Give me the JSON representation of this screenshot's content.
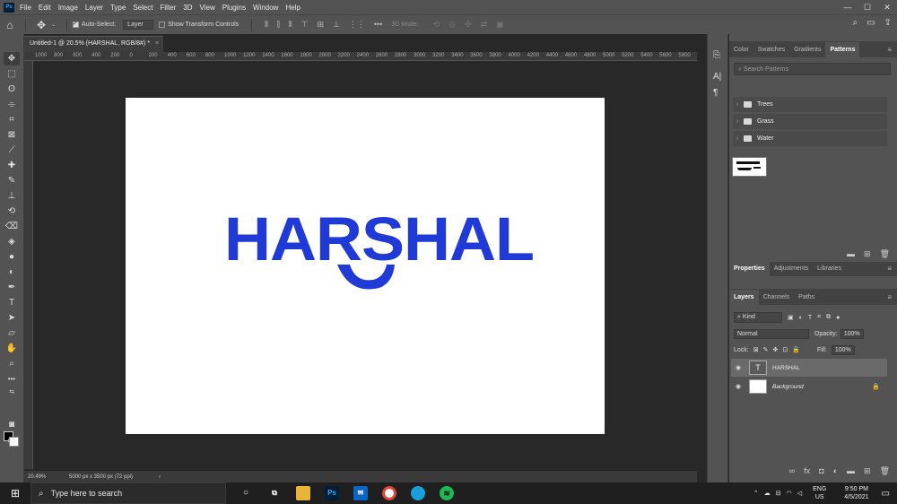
{
  "menu": {
    "items": [
      "File",
      "Edit",
      "Image",
      "Layer",
      "Type",
      "Select",
      "Filter",
      "3D",
      "View",
      "Plugins",
      "Window",
      "Help"
    ],
    "window_controls": [
      "—",
      "☐",
      "✕"
    ]
  },
  "options": {
    "auto_select_label": "Auto-Select:",
    "auto_select_value": "Layer",
    "transform_controls_label": "Show Transform Controls",
    "mode_3d_label": "3D Mode:"
  },
  "document": {
    "tab_title": "Untitled-1 @ 20.5% (HARSHAL, RGB/8#) *",
    "tab_close": "×",
    "canvas_text": "HARSHAL",
    "canvas_text_color": "#1f3ad6",
    "canvas_bg": "#ffffff",
    "ruler_labels": [
      "1000",
      "800",
      "600",
      "400",
      "200",
      "0",
      "200",
      "400",
      "600",
      "800",
      "1000",
      "1200",
      "1400",
      "1600",
      "1800",
      "2000",
      "2200",
      "2400",
      "2600",
      "2800",
      "3000",
      "3200",
      "3400",
      "3600",
      "3800",
      "4000",
      "4200",
      "4400",
      "4600",
      "4800",
      "5000",
      "5200",
      "5400",
      "5600",
      "5800"
    ]
  },
  "status": {
    "zoom": "20.49%",
    "doc_size": "5000 px x 3500 px (72 ppi)",
    "arrow": "›"
  },
  "toolbar": {
    "tools": [
      "move-tool-icon",
      "marquee-tool-icon",
      "lasso-tool-icon",
      "quick-select-tool-icon",
      "crop-tool-icon",
      "frame-tool-icon",
      "eyedropper-tool-icon",
      "healing-brush-tool-icon",
      "brush-tool-icon",
      "clone-stamp-tool-icon",
      "history-brush-tool-icon",
      "eraser-tool-icon",
      "paint-bucket-tool-icon",
      "blur-tool-icon",
      "dodge-tool-icon",
      "pen-tool-icon",
      "type-tool-icon",
      "path-select-tool-icon",
      "rectangle-tool-icon",
      "hand-tool-icon",
      "zoom-tool-icon"
    ]
  },
  "patterns_panel": {
    "tabs": [
      "Color",
      "Swatches",
      "Gradients",
      "Patterns"
    ],
    "active_tab": "Patterns",
    "search_placeholder": "Search Patterns",
    "folders": [
      "Trees",
      "Grass",
      "Water"
    ]
  },
  "properties_panel": {
    "tabs": [
      "Properties",
      "Adjustments",
      "Libraries"
    ]
  },
  "layers_panel": {
    "tabs": [
      "Layers",
      "Channels",
      "Paths"
    ],
    "filter_kind": "Kind",
    "blend_mode": "Normal",
    "opacity_label": "Opacity:",
    "opacity_value": "100%",
    "lock_label": "Lock:",
    "fill_label": "Fill:",
    "fill_value": "100%",
    "layers": [
      {
        "name": "HARSHAL",
        "type": "text",
        "selected": true
      },
      {
        "name": "Background",
        "type": "pixel",
        "locked": true
      }
    ]
  },
  "taskbar": {
    "search_placeholder": "Type here to search",
    "lang_top": "ENG",
    "lang_bottom": "US",
    "time": "9:50 PM",
    "date": "4/5/2021",
    "apps": [
      "task-view-icon",
      "file-explorer-icon",
      "photoshop-icon",
      "mail-icon",
      "chrome-icon",
      "edge-icon",
      "spotify-icon"
    ]
  }
}
